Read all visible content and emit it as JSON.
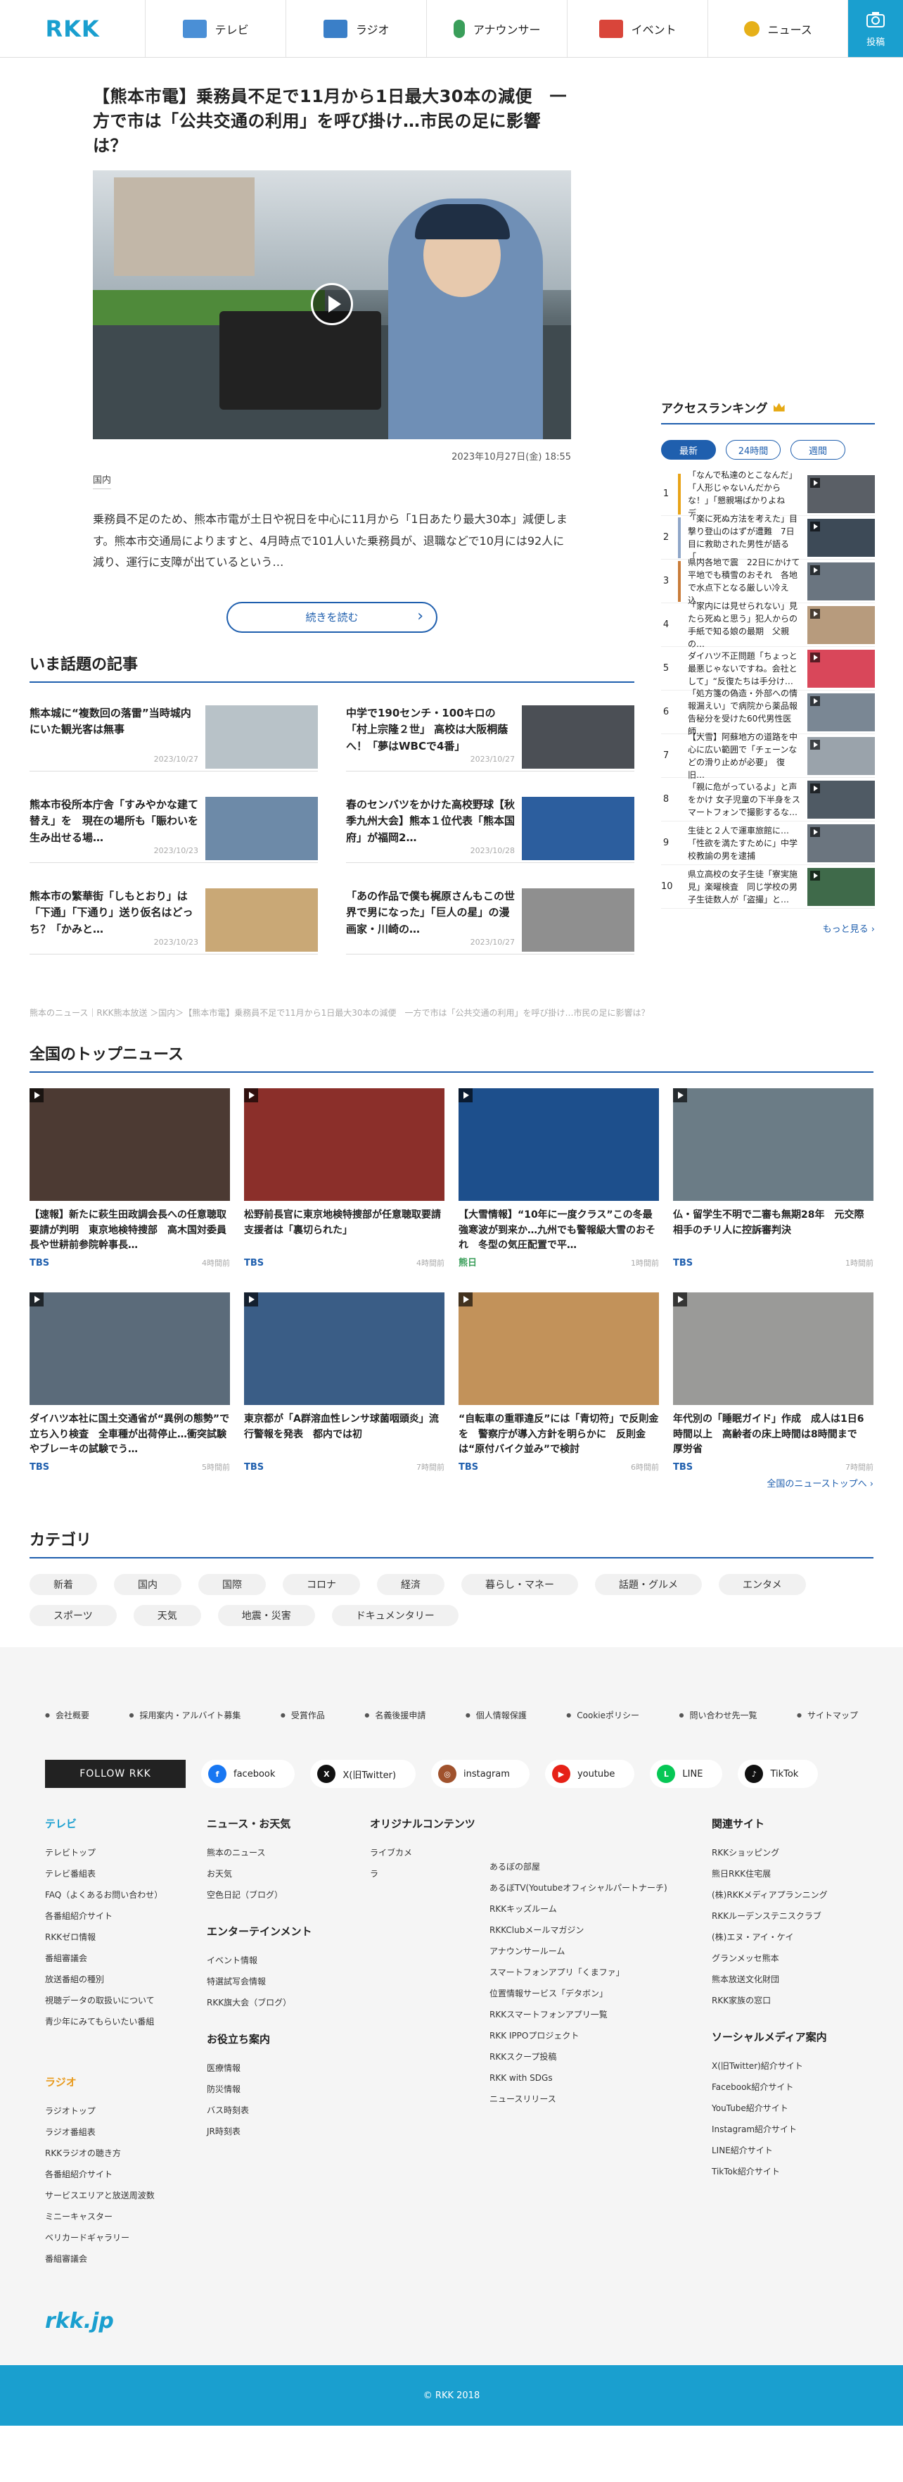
{
  "header": {
    "logo": "RKK",
    "nav": [
      {
        "label": "テレビ",
        "icon": "tv-icon",
        "color": "#4a8fd6"
      },
      {
        "label": "ラジオ",
        "icon": "radio-icon",
        "color": "#3a7fc8"
      },
      {
        "label": "アナウンサー",
        "icon": "microphone-icon",
        "color": "#3a9e5a"
      },
      {
        "label": "イベント",
        "icon": "event-icon",
        "color": "#d9453a"
      },
      {
        "label": "ニュース",
        "icon": "news-icon",
        "color": "#e6b019"
      }
    ],
    "post_label": "投稿"
  },
  "lead": {
    "title": "【熊本市電】乗務員不足で11月から1日最大30本の減便　一方で市は「公共交通の利用」を呼び掛け…市民の足に影響は？",
    "date": "2023年10月27日(金) 18:55",
    "category": "国内",
    "body": "乗務員不足のため、熊本市電が土日や祝日を中心に11月から「1日あたり最大30本」減便します。熊本市交通局によりますと、4月時点で101人いた乗務員が、退職などで10月には92人に減り、運行に支障が出ているという…",
    "more_label": "続きを読む"
  },
  "topics": {
    "title": "いま話題の記事",
    "items": [
      {
        "title": "熊本城に“複数回の落雷”当時城内にいた観光客は無事",
        "date": "2023/10/27",
        "color": "#b8c2c8"
      },
      {
        "title": "中学で190センチ・100キロの「村上宗隆２世」 高校は大阪桐蔭へ！「夢はWBCで4番」",
        "date": "2023/10/27",
        "color": "#4b4f55"
      },
      {
        "title": "熊本市役所本庁舎「すみやかな建て替え」を　現在の場所も「賑わいを生み出せる場…",
        "date": "2023/10/23",
        "color": "#6d8aa8"
      },
      {
        "title": "春のセンバツをかけた高校野球【秋季九州大会】熊本１位代表「熊本国府」が福岡2…",
        "date": "2023/10/28",
        "color": "#2c5e9e"
      },
      {
        "title": "熊本市の繁華街「しもとおり」は「下通」「下通り」送り仮名はどっち？「かみと…",
        "date": "2023/10/23",
        "color": "#c9a876"
      },
      {
        "title": "「あの作品で僕も梶原さんもこの世界で男になった」「巨人の星」の漫画家・川崎の…",
        "date": "2023/10/27",
        "color": "#8f8f8f"
      }
    ]
  },
  "breadcrumb": "熊本のニュース｜RKK熊本放送 ＞国内＞【熊本市電】乗務員不足で11月から1日最大30本の減便　一方で市は「公共交通の利用」を呼び掛け…市民の足に影響は？",
  "ranking": {
    "title": "アクセスランキング",
    "tabs": [
      "最新",
      "24時間",
      "週間"
    ],
    "items": [
      {
        "no": "1",
        "text": "「なんで私達のとこなんだ」「人形じゃないんだからな！」「懇親場ばかりよね デ…",
        "bar": "#e8a317",
        "color": "#5a5f66"
      },
      {
        "no": "2",
        "text": "「楽に死ぬ方法を考えた」目撃り登山のはずが遭難　7日目に救助された男性が語る「…",
        "bar": "#8fa6c8",
        "color": "#3d4a57"
      },
      {
        "no": "3",
        "text": "県内各地で震　22日にかけて平地でも積雪のおそれ　各地で水点下となる厳しい冷え込…",
        "bar": "#c97c3a",
        "color": "#6a7580"
      },
      {
        "no": "4",
        "text": "「家内には見せられない」見たら死ぬと思う」犯人からの手紙で知る娘の最期　父親の…",
        "bar": "#ffffff",
        "color": "#b79b7d"
      },
      {
        "no": "5",
        "text": "ダイハツ不正問題「ちょっと最悪じゃないですね。会社として」“反復たちは手分け…",
        "bar": "#ffffff",
        "color": "#d9475a"
      },
      {
        "no": "6",
        "text": "「処方箋の偽造・外部への情報漏えい」で病院から薬品報告秘分を受けた60代男性医師…",
        "bar": "#ffffff",
        "color": "#7a8794"
      },
      {
        "no": "7",
        "text": "【大雪】阿蘇地方の道路を中心に広い範囲で「チェーンなどの滑り止めが必要」　復旧…",
        "bar": "#ffffff",
        "color": "#9aa3ab"
      },
      {
        "no": "8",
        "text": "「親に危がっているよ」と声をかけ 女子児童の下半身をスマートフォンで撮影するな…",
        "bar": "#ffffff",
        "color": "#4f5a64"
      },
      {
        "no": "9",
        "text": "生徒と２人で運車旅館に…「性欲を満たすために」中学校教諭の男を逮捕",
        "bar": "#ffffff",
        "color": "#6b757f"
      },
      {
        "no": "10",
        "text": "県立高校の女子生徒「寮実施見」楽曜検査　同じ学校の男子生徒数人が「盗撮」と…",
        "bar": "#ffffff",
        "color": "#3f6a4a"
      }
    ],
    "more_label": "もっと見る ›"
  },
  "national": {
    "title": "全国のトップニュース",
    "items": [
      {
        "title": "【速報】新たに萩生田政調会長への任意聴取要請が判明　東京地検特捜部　高木国対委員長や世耕前参院幹事長…",
        "source": "TBS",
        "time": "4時間前",
        "color": "#4c3a33"
      },
      {
        "title": "松野前長官に東京地検特捜部が任意聴取要請 支援者は「裏切られた」",
        "source": "TBS",
        "time": "4時間前",
        "color": "#8b2f2a"
      },
      {
        "title": "【大雪情報】“10年に一度クラス”この冬最強寒波が到来か…九州でも警報級大雪のおそれ　冬型の気圧配置で平…",
        "source": "熊日",
        "time": "1時間前",
        "color": "#1d4f8c"
      },
      {
        "title": "仏・留学生不明で二審も無期28年　元交際相手のチリ人に控訴審判決",
        "source": "TBS",
        "time": "1時間前",
        "color": "#6b7c86"
      },
      {
        "title": "ダイハツ本社に国土交通省が“異例の態勢”で立ち入り検査　全車種が出荷停止…衝突試験やブレーキの試験でう…",
        "source": "TBS",
        "time": "5時間前",
        "color": "#5b6b7a"
      },
      {
        "title": "東京都が「A群溶血性レンサ球菌咽頭炎」流行警報を発表　都内では初",
        "source": "TBS",
        "time": "7時間前",
        "color": "#3a5d86"
      },
      {
        "title": "“自転車の重罪違反”には「青切符」で反則金を　警察庁が導入方針を明らかに　反則金は“原付バイク並み”で検討",
        "source": "TBS",
        "time": "6時間前",
        "color": "#c2925a"
      },
      {
        "title": "年代別の「睡眠ガイド」作成　成人は1日6時間以上　高齢者の床上時間は8時間まで　厚労省",
        "source": "TBS",
        "time": "7時間前",
        "color": "#9a9a98"
      }
    ],
    "more_label": "全国のニューストップへ ›"
  },
  "category": {
    "title": "カテゴリ",
    "items": [
      "新着",
      "国内",
      "国際",
      "コロナ",
      "経済",
      "暮らし・マネー",
      "話題・グルメ",
      "エンタメ",
      "スポーツ",
      "天気",
      "地震・災害",
      "ドキュメンタリー"
    ]
  },
  "footer": {
    "links": [
      "会社概要",
      "採用案内・アルバイト募集",
      "受賞作品",
      "名義後援申請",
      "個人情報保護",
      "Cookieポリシー",
      "問い合わせ先一覧",
      "サイトマップ"
    ],
    "follow_label": "FOLLOW RKK",
    "social": [
      {
        "label": "facebook",
        "mark": "f",
        "color": "#1877f2"
      },
      {
        "label": "X(旧Twitter)",
        "mark": "X",
        "color": "#111111"
      },
      {
        "label": "instagram",
        "mark": "◎",
        "color": "#a0522d"
      },
      {
        "label": "youtube",
        "mark": "▶",
        "color": "#e62117"
      },
      {
        "label": "LINE",
        "mark": "L",
        "color": "#06c755"
      },
      {
        "label": "TikTok",
        "mark": "♪",
        "color": "#111111"
      }
    ],
    "tv": {
      "title": "テレビ",
      "items": [
        "テレビトップ",
        "テレビ番組表",
        "FAQ（よくあるお問い合わせ）",
        "各番組紹介サイト",
        "RKKゼロ情報",
        "番組審議会",
        "放送番組の種別",
        "視聴データの取扱いについて",
        "青少年にみてもらいたい番組"
      ]
    },
    "radio": {
      "title": "ラジオ",
      "items": [
        "ラジオトップ",
        "ラジオ番組表",
        "RKKラジオの聴き方",
        "各番組紹介サイト",
        "サービスエリアと放送周波数",
        "ミニーキャスター",
        "ベリカードギャラリー",
        "番組審議会"
      ]
    },
    "news": {
      "title": "ニュース・お天気",
      "items": [
        "熊本のニュース",
        "お天気",
        "空色日記（ブログ）"
      ]
    },
    "ent": {
      "title": "エンターテインメント",
      "items": [
        "イベント情報",
        "特選試写会情報",
        "RKK旗大会（ブログ）"
      ]
    },
    "useful": {
      "title": "お役立ち案内",
      "items": [
        "医療情報",
        "防災情報",
        "バス時刻表",
        "JR時刻表"
      ]
    },
    "original": {
      "title": "オリジナルコンテンツ",
      "items_a": [
        "ライブカメラ"
      ],
      "items_b": [
        "あるぼの部屋",
        "あるぼTV(Youtubeオフィシャルパートナーチ)",
        "RKKキッズルーム",
        "RKKClubメールマガジン",
        "アナウンサールーム",
        "スマートフォンアプリ「くまファ」",
        "位置情報サービス「デタボン」",
        "RKKスマートフォンアプリ一覧",
        "RKK IPPOプロジェクト",
        "RKKスクープ投稿",
        "RKK with SDGs",
        "ニュースリリース"
      ]
    },
    "related": {
      "title": "関連サイト",
      "items": [
        "RKKショッピング",
        "熊日RKK住宅展",
        "(株)RKKメディアプランニング",
        "RKKルーデンステニスクラブ",
        "(株)エヌ・アイ・ケイ",
        "グランメッセ熊本",
        "熊本放送文化財団",
        "RKK家族の窓口"
      ]
    },
    "sns": {
      "title": "ソーシャルメディア案内",
      "items": [
        "X(旧Twitter)紹介サイト",
        "Facebook紹介サイト",
        "YouTube紹介サイト",
        "Instagram紹介サイト",
        "LINE紹介サイト",
        "TikTok紹介サイト"
      ]
    },
    "logo": "rkk.jp",
    "copyright": "© RKK 2018"
  },
  "colors": {
    "brand": "#1a9fcf",
    "accent": "#1f5fae"
  }
}
